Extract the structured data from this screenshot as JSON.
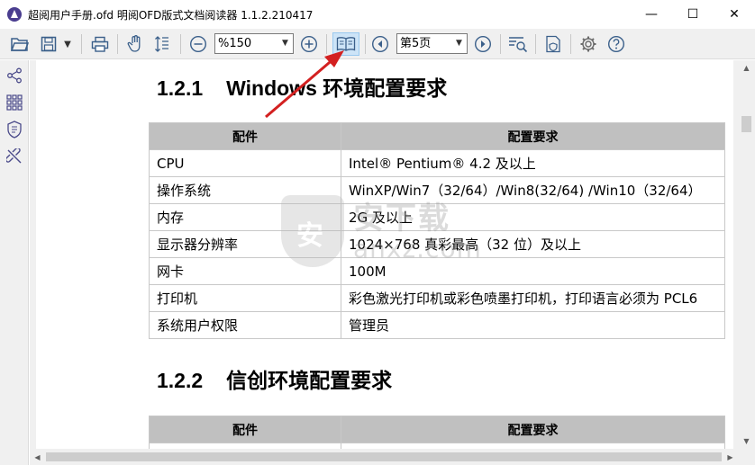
{
  "window": {
    "title": "超阅用户手册.ofd 明阅OFD版式文档阅读器 1.1.2.210417",
    "minimize_glyph": "—",
    "maximize_glyph": "☐",
    "close_glyph": "✕"
  },
  "toolbar": {
    "zoom_value": "%150",
    "page_value": "第5页",
    "dropdown_glyph": "▼",
    "icons": [
      "open-folder-icon",
      "save-icon",
      "save-dropdown-icon",
      "print-icon",
      "hand-tool-icon",
      "fit-height-icon",
      "zoom-out-icon",
      "zoom-in-icon",
      "book-view-icon",
      "previous-page-icon",
      "next-page-icon",
      "search-list-icon",
      "verify-document-icon",
      "settings-gear-icon",
      "help-icon"
    ]
  },
  "sidebar": {
    "icons": [
      "share-icon",
      "thumbnails-grid-icon",
      "certificate-shield-icon",
      "unlink-icon"
    ]
  },
  "document": {
    "section1": {
      "number": "1.2.1",
      "title": "Windows 环境配置要求"
    },
    "table1": {
      "headers": [
        "配件",
        "配置要求"
      ],
      "rows": [
        [
          "CPU",
          "Intel® Pentium® 4.2 及以上"
        ],
        [
          "操作系统",
          "WinXP/Win7（32/64）/Win8(32/64) /Win10（32/64）"
        ],
        [
          "内存",
          "2G 及以上"
        ],
        [
          "显示器分辨率",
          "1024×768 真彩最高（32 位）及以上"
        ],
        [
          "网卡",
          "100M"
        ],
        [
          "打印机",
          "彩色激光打印机或彩色喷墨打印机，打印语言必须为 PCL6"
        ],
        [
          "系统用户权限",
          "管理员"
        ]
      ]
    },
    "section2": {
      "number": "1.2.2",
      "title": "信创环境配置要求"
    },
    "table2": {
      "headers": [
        "配件",
        "配置要求"
      ]
    }
  },
  "watermark": {
    "line1": "安下载",
    "line2": "anxz.com"
  },
  "scrollbars": {
    "up_glyph": "▲",
    "down_glyph": "▼",
    "left_glyph": "◀",
    "right_glyph": "▶"
  },
  "colors": {
    "annotation_arrow": "#d32020",
    "table_header_bg": "#c0c0c0",
    "toolbar_bg": "#f0f0f0",
    "active_button_bg": "#cde4f7"
  }
}
